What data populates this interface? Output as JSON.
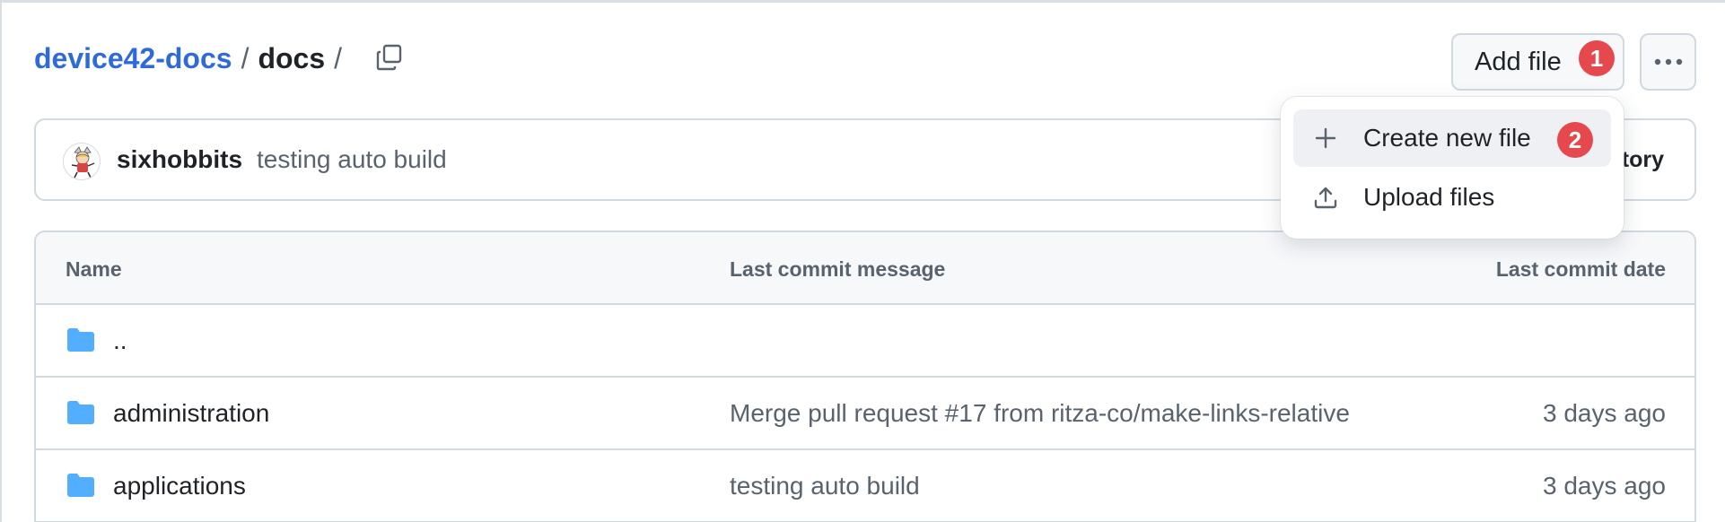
{
  "breadcrumb": {
    "repo": "device42-docs",
    "separator": "/",
    "dir": "docs",
    "trailing_separator": "/"
  },
  "toolbar": {
    "add_file_label": "Add file",
    "add_file_badge": "1"
  },
  "commit": {
    "author": "sixhobbits",
    "message": "testing auto build",
    "history_label_partial": "tory"
  },
  "menu": {
    "items": [
      {
        "label": "Create new file",
        "icon": "plus-icon"
      },
      {
        "label": "Upload files",
        "icon": "upload-icon"
      }
    ],
    "badge": "2"
  },
  "table": {
    "headers": {
      "name": "Name",
      "message": "Last commit message",
      "date": "Last commit date"
    },
    "rows": [
      {
        "name": "..",
        "message": "",
        "date": ""
      },
      {
        "name": "administration",
        "message": "Merge pull request #17 from ritza-co/make-links-relative",
        "date": "3 days ago"
      },
      {
        "name": "applications",
        "message": "testing auto build",
        "date": "3 days ago"
      }
    ]
  },
  "colors": {
    "link": "#2f6bd8",
    "folder": "#54aeff",
    "badge": "#e5484d",
    "muted_text": "#59636e",
    "border": "#d1d9e0"
  }
}
